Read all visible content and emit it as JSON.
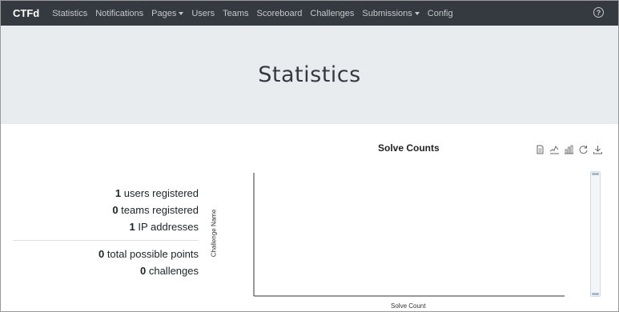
{
  "navbar": {
    "brand": "CTFd",
    "items": [
      {
        "label": "Statistics"
      },
      {
        "label": "Notifications"
      },
      {
        "label": "Pages"
      },
      {
        "label": "Users"
      },
      {
        "label": "Teams"
      },
      {
        "label": "Scoreboard"
      },
      {
        "label": "Challenges"
      },
      {
        "label": "Submissions"
      },
      {
        "label": "Config"
      }
    ],
    "help_icon": "question-circle-icon"
  },
  "jumbotron": {
    "title": "Statistics"
  },
  "stats": {
    "users_count": "1",
    "users_text": "users registered",
    "teams_count": "0",
    "teams_text": "teams registered",
    "ip_count": "1",
    "ip_text": "IP addresses",
    "points_count": "0",
    "points_text": "total possible points",
    "challenges_count": "0",
    "challenges_text": "challenges"
  },
  "chart_data": {
    "type": "bar",
    "title": "Solve Counts",
    "xlabel": "Solve Count",
    "ylabel": "Challenge Name",
    "categories": [],
    "values": [],
    "toolbox": [
      "data-view-icon",
      "line-chart-icon",
      "bar-chart-icon",
      "restore-icon",
      "save-image-icon"
    ]
  }
}
